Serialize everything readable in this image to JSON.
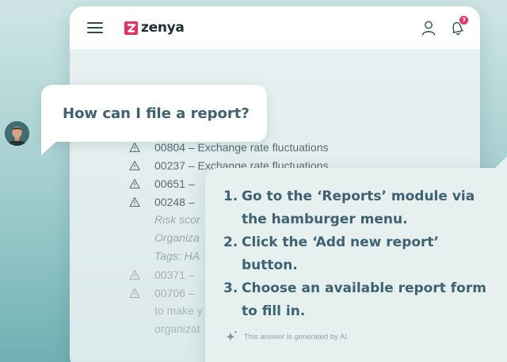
{
  "app": {
    "brand": "zenya",
    "notification_count": "3"
  },
  "risks": [
    {
      "text": "00804 – Exchange rate fluctuations"
    },
    {
      "text": "00237 – Exchange rate fluctuations"
    },
    {
      "text": "00651 –"
    },
    {
      "text": "00248 –"
    }
  ],
  "risk_details": [
    {
      "text": "Risk scor"
    },
    {
      "text": "Organiza"
    },
    {
      "text": "Tags: HA"
    }
  ],
  "risks_more": [
    {
      "text": "00371 –"
    },
    {
      "text": "00706 –"
    }
  ],
  "risk_trailing": [
    {
      "text": "to make y"
    },
    {
      "text": "organizat"
    }
  ],
  "chat": {
    "question": "How can I file a report?",
    "answer_steps": [
      {
        "num": "1.",
        "text": "Go to the ‘Reports’ module via the hamburger menu."
      },
      {
        "num": "2.",
        "text": "Click the ‘Add new report’ button."
      },
      {
        "num": "3.",
        "text": "Choose an available report form to fill in."
      }
    ],
    "ai_note": "This answer is generated by AI."
  },
  "colors": {
    "brand_accent": "#e5345c",
    "text_primary": "#3d6271"
  },
  "icons": {
    "menu": "hamburger-menu-icon",
    "user": "user-icon",
    "notifications": "bell-icon",
    "warning": "warning-triangle-icon",
    "sparkle": "sparkle-icon"
  }
}
